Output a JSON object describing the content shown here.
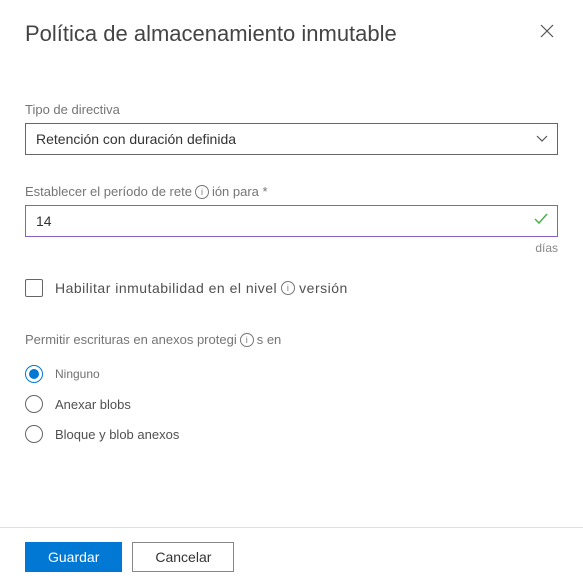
{
  "header": {
    "title": "Política de almacenamiento inmutable"
  },
  "policyType": {
    "label": "Tipo de directiva",
    "selected": "Retención con duración definida"
  },
  "retention": {
    "label_before": "Establecer el período de rete",
    "label_after": "ión para *",
    "value": "14",
    "unit": "días"
  },
  "versionImmutability": {
    "label_before": "Habilitar  inmutabilidad  en  el  nivel ",
    "label_after": " versión"
  },
  "appendWrites": {
    "label_before": "Permitir escrituras en anexos protegi",
    "label_after": "s en",
    "options": {
      "none": "Ninguno",
      "append": "Anexar blobs",
      "block": "Bloque y blob anexos"
    }
  },
  "footer": {
    "save": "Guardar",
    "cancel": "Cancelar"
  }
}
